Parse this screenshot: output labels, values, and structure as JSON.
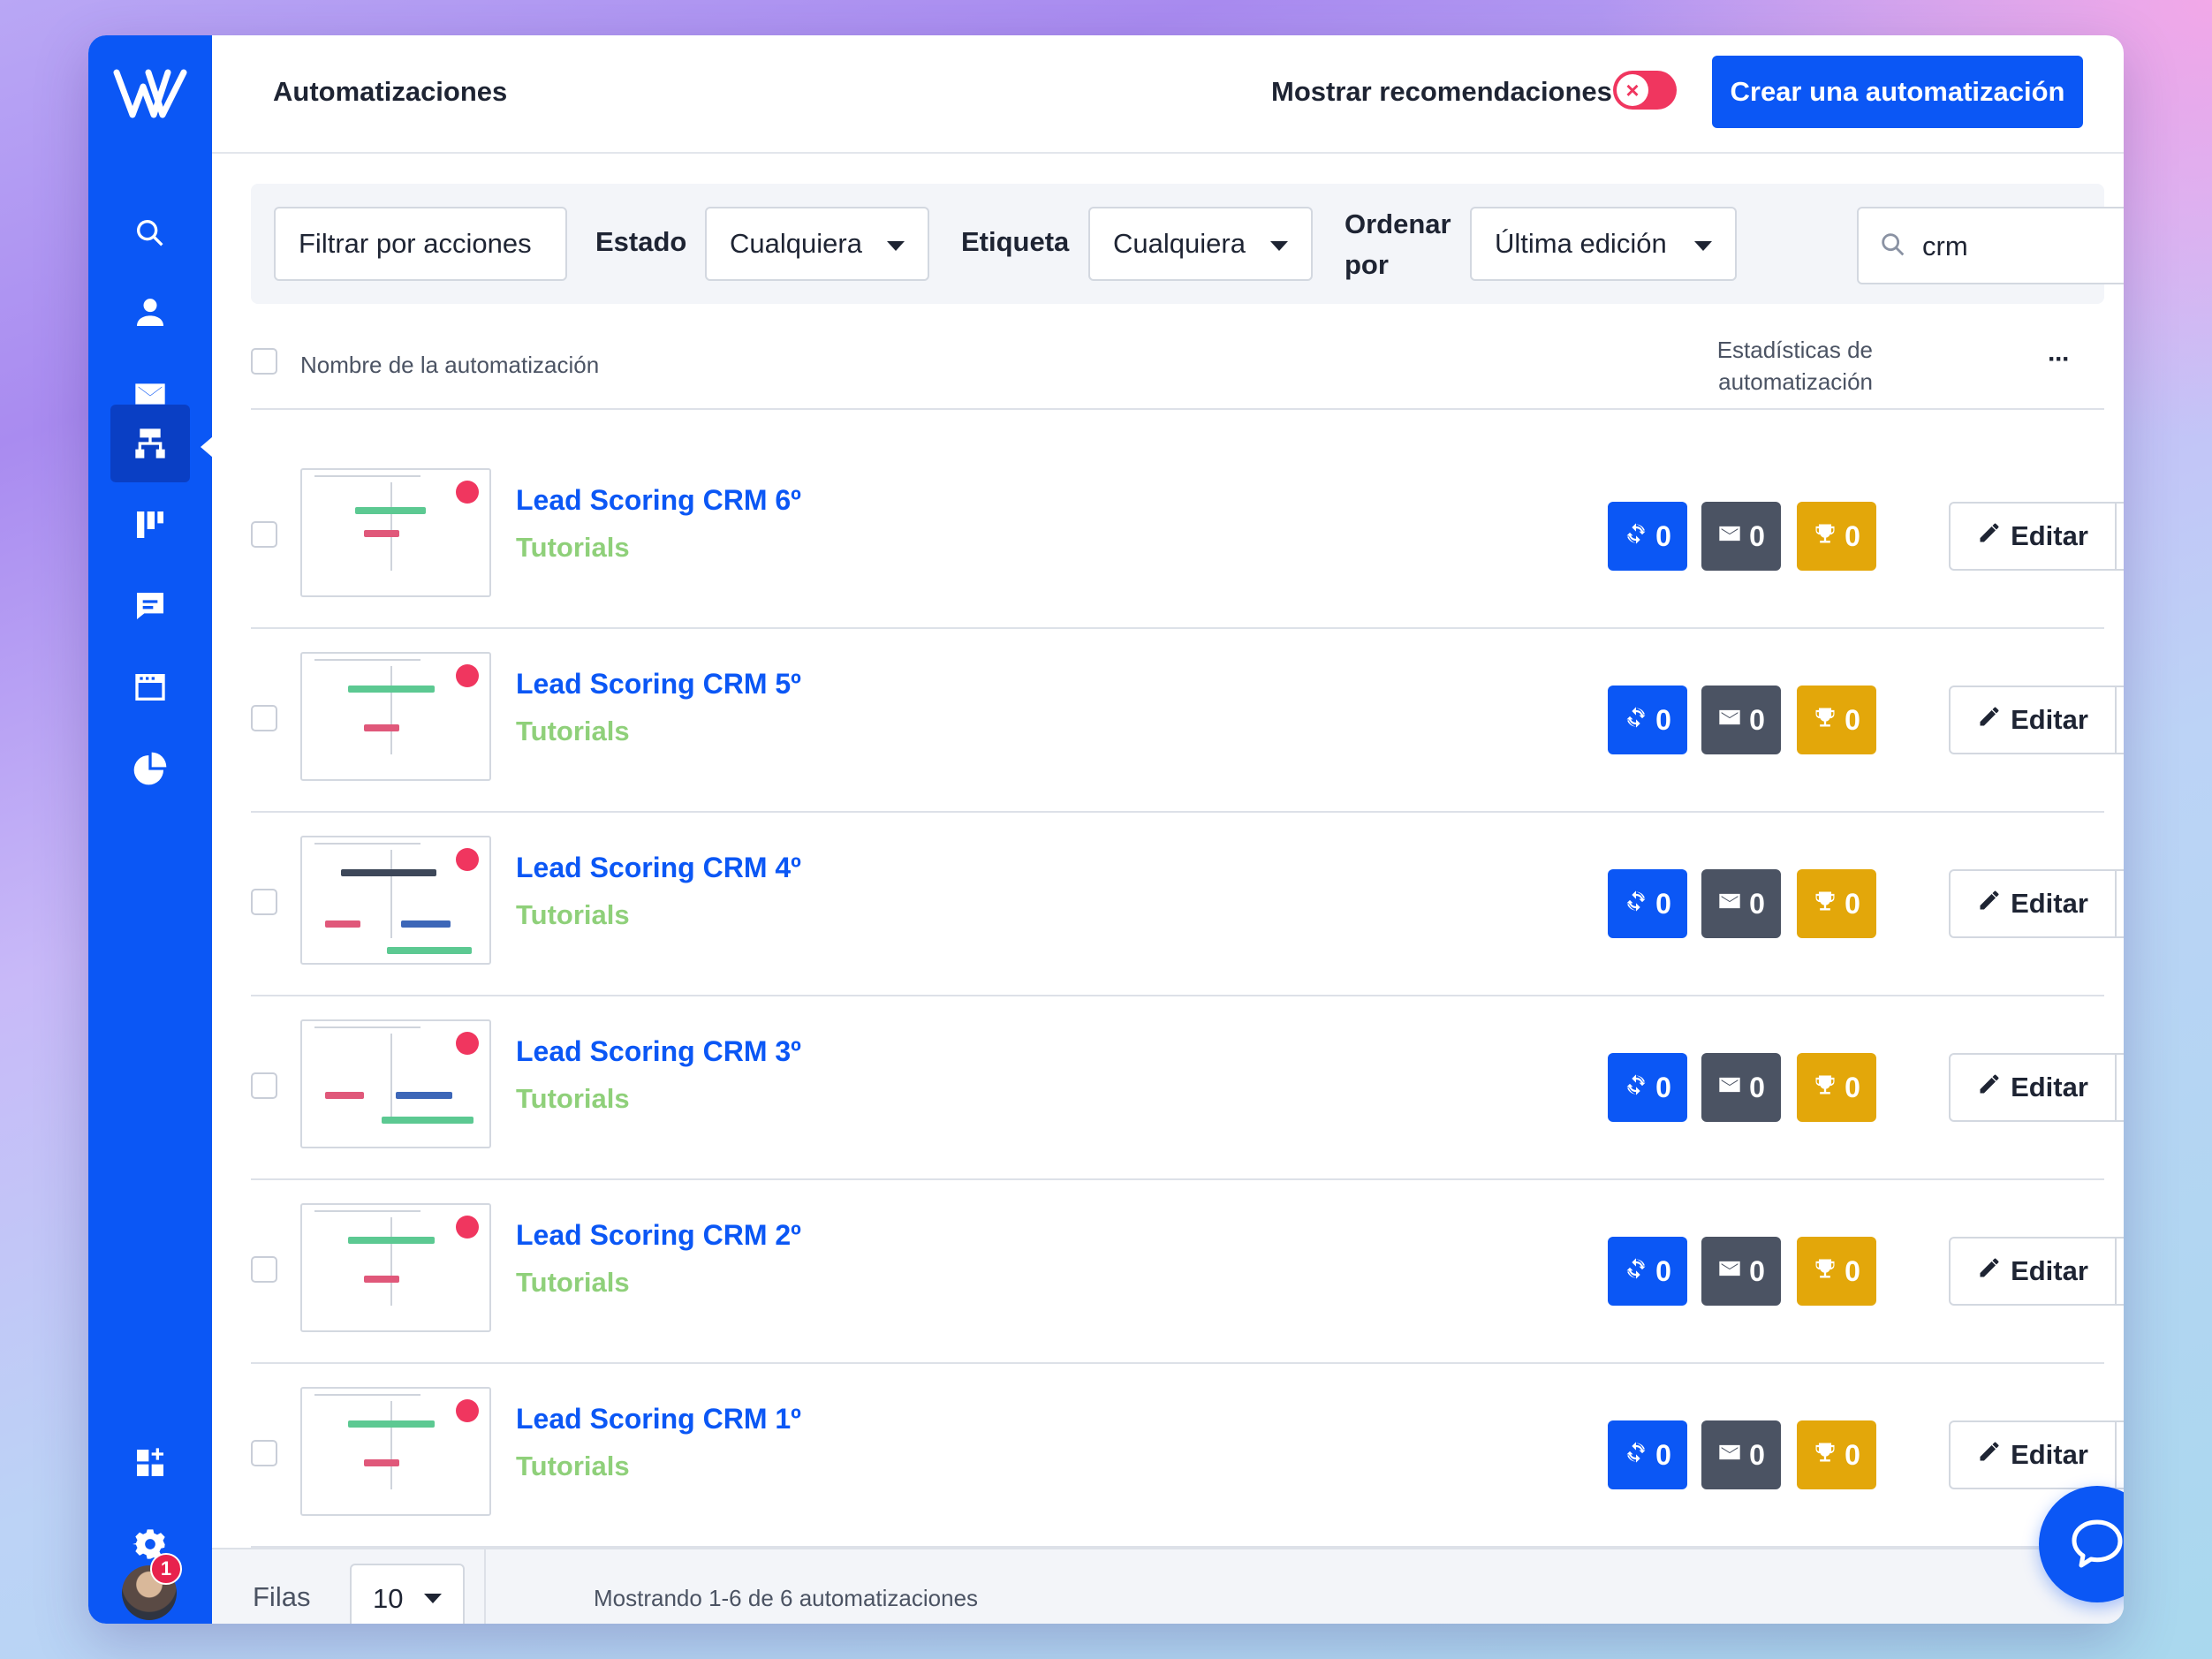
{
  "app": {
    "title": "Automatizaciones",
    "recommendations_label": "Mostrar recomendaciones",
    "recommendations_enabled": false,
    "create_button": "Crear una automatización",
    "accent_color": "#0b57f5"
  },
  "sidebar": {
    "items": [
      {
        "name": "search-icon",
        "active": false
      },
      {
        "name": "contacts-icon",
        "active": false
      },
      {
        "name": "email-icon",
        "active": false
      },
      {
        "name": "automations-icon",
        "active": true
      },
      {
        "name": "pipelines-icon",
        "active": false
      },
      {
        "name": "conversations-icon",
        "active": false
      },
      {
        "name": "website-icon",
        "active": false
      },
      {
        "name": "reports-icon",
        "active": false
      },
      {
        "name": "apps-icon",
        "active": false
      },
      {
        "name": "settings-icon",
        "active": false
      }
    ],
    "notification_count": "1"
  },
  "filters": {
    "actions_button": "Filtrar por acciones",
    "status_label": "Estado",
    "status_value": "Cualquiera",
    "tag_label": "Etiqueta",
    "tag_value": "Cualquiera",
    "sort_label_1": "Ordenar",
    "sort_label_2": "por",
    "sort_value": "Última edición",
    "search_value": "crm"
  },
  "table": {
    "col_name": "Nombre de la automatización",
    "col_stats_1": "Estadísticas de",
    "col_stats_2": "automatización",
    "more": "···",
    "edit_label": "Editar",
    "rows": [
      {
        "name": "Lead Scoring CRM 6º",
        "tag": "Tutorials",
        "active": "0",
        "emails": "0",
        "goals": "0"
      },
      {
        "name": "Lead Scoring CRM 5º",
        "tag": "Tutorials",
        "active": "0",
        "emails": "0",
        "goals": "0"
      },
      {
        "name": "Lead Scoring CRM 4º",
        "tag": "Tutorials",
        "active": "0",
        "emails": "0",
        "goals": "0"
      },
      {
        "name": "Lead Scoring CRM 3º",
        "tag": "Tutorials",
        "active": "0",
        "emails": "0",
        "goals": "0"
      },
      {
        "name": "Lead Scoring CRM 2º",
        "tag": "Tutorials",
        "active": "0",
        "emails": "0",
        "goals": "0"
      },
      {
        "name": "Lead Scoring CRM 1º",
        "tag": "Tutorials",
        "active": "0",
        "emails": "0",
        "goals": "0"
      }
    ]
  },
  "footer": {
    "rows_label": "Filas",
    "rows_value": "10",
    "showing": "Mostrando 1-6 de 6 automatizaciones"
  }
}
